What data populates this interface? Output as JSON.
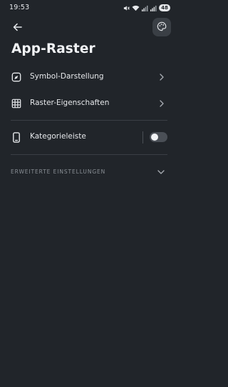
{
  "status_bar": {
    "time": "19:53",
    "battery": "48",
    "icons": [
      "mute-icon",
      "wifi-icon",
      "signal-icon",
      "signal-icon",
      "battery-icon"
    ]
  },
  "header": {
    "back_icon": "arrow-left-icon",
    "palette_icon": "palette-icon",
    "title": "App-Raster"
  },
  "settings": {
    "items": [
      {
        "label": "Symbol-Darstellung",
        "icon": "symbol-icon"
      },
      {
        "label": "Raster-Eigenschaften",
        "icon": "grid-icon"
      }
    ],
    "toggle_item": {
      "label": "Kategorieleiste",
      "icon": "phone-icon",
      "enabled": false
    },
    "advanced_section": {
      "label": "ERWEITERTE EINSTELLUNGEN",
      "expanded": false
    }
  },
  "colors": {
    "background": "#21252a",
    "text": "#e6e8eb",
    "muted": "#8a9096",
    "divider": "#3a3f45"
  }
}
